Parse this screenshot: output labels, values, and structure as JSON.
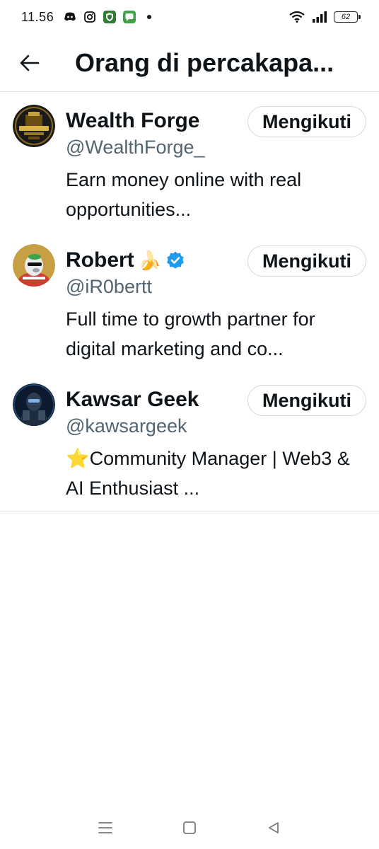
{
  "status_bar": {
    "time": "11.56",
    "battery": "62",
    "icons": [
      "discord-icon",
      "instagram-icon",
      "shield-app-icon",
      "chat-app-icon",
      "notification-dot",
      "wifi-icon",
      "signal-icon",
      "battery-icon"
    ]
  },
  "header": {
    "title": "Orang di percakapa...",
    "back_icon": "arrow-left-icon"
  },
  "users": [
    {
      "name": "Wealth Forge",
      "handle": "@WealthForge_",
      "bio": "Earn money online with real opportunities...",
      "button": "Mengikuti",
      "verified": false,
      "emoji": ""
    },
    {
      "name": "Robert",
      "handle": "@iR0bertt",
      "bio": "Full time to growth partner for digital marketing and co...",
      "button": "Mengikuti",
      "verified": true,
      "emoji": "🍌"
    },
    {
      "name": "Kawsar Geek",
      "handle": "@kawsargeek",
      "bio": "⭐Community Manager | Web3 & AI Enthusiast ...",
      "button": "Mengikuti",
      "verified": false,
      "emoji": ""
    }
  ],
  "nav": {
    "icons": [
      "menu-icon",
      "home-square-icon",
      "back-triangle-icon"
    ]
  },
  "colors": {
    "text_primary": "#0f1419",
    "text_secondary": "#536471",
    "border": "#cfd9de",
    "verified": "#1d9bf0"
  }
}
